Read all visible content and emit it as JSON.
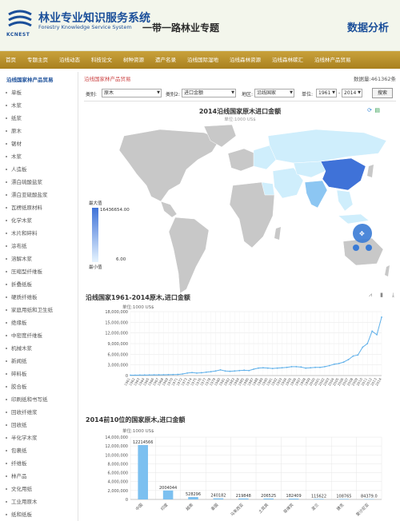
{
  "header": {
    "logo_text": "KCNEST",
    "title": "林业专业知识服务系统",
    "subtitle": "Forestry Knowledge Service System",
    "topic": "一带一路林业专题",
    "right_title": "数据分析"
  },
  "nav": [
    "首页",
    "专题主页",
    "沿线动态",
    "科技论文",
    "树种资源",
    "遗产名录",
    "沿线国际湿地",
    "沿线森林资源",
    "沿线森林碳汇",
    "沿线林产品贸易"
  ],
  "sidebar": {
    "title": "沿线国家林产品贸易",
    "items": [
      "单板",
      "木浆",
      "纸浆",
      "原木",
      "锯材",
      "木浆",
      "人造板",
      "漂白硫酸盐浆",
      "漂白亚硫酸盐浆",
      "瓦楞纸原材料",
      "化学木浆",
      "木片和碎料",
      "涂布纸",
      "溶解木浆",
      "压缩型纤维板",
      "折叠纸板",
      "硬质纤维板",
      "家庭用纸和卫生纸",
      "绝缘板",
      "中密度纤维板",
      "机械木浆",
      "新闻纸",
      "碎料板",
      "胶合板",
      "印刷纸和书写纸",
      "回收纤维浆",
      "回收纸",
      "半化学木浆",
      "包裹纸",
      "纤维板",
      "林产品",
      "文化用纸",
      "工业用原木",
      "纸和纸板"
    ]
  },
  "main": {
    "breadcrumb": "沿线国家林产品贸易",
    "data_count": "数据量:461362条"
  },
  "filters": {
    "category_label": "类别:",
    "category_value": "原木",
    "category2_label": "类别2:",
    "category2_value": "进口金额",
    "region_label": "地区:",
    "region_value": "沿线国家",
    "unit_label": "单位:",
    "year_from": "1961",
    "year_sep": "-",
    "year_to": "2014",
    "search_label": "搜索"
  },
  "map": {
    "title": "2014沿线国家原木进口金额",
    "unit": "单位:1000 US$",
    "legend_max_label": "最大值",
    "legend_max_value": "16436654.00",
    "legend_min_label": "最小值",
    "legend_min_value": "6.00",
    "colors": {
      "land": "#c8c8c8",
      "light": "#cfeefc",
      "mid": "#8cc6f2",
      "china": "#3f72d8"
    }
  },
  "chart_data": [
    {
      "type": "line",
      "title": "沿线国家1961-2014原木,进口金额",
      "ylabel": "单位:1000 US$",
      "ylim": [
        0,
        18000000
      ],
      "yticks": [
        "18,000,000",
        "15,000,000",
        "12,000,000",
        "9,000,000",
        "6,000,000",
        "3,000,000",
        "0"
      ],
      "x": [
        "1961",
        "1962",
        "1963",
        "1964",
        "1965",
        "1966",
        "1967",
        "1968",
        "1969",
        "1970",
        "1971",
        "1972",
        "1973",
        "1974",
        "1975",
        "1976",
        "1977",
        "1978",
        "1979",
        "1980",
        "1981",
        "1982",
        "1983",
        "1984",
        "1985",
        "1986",
        "1987",
        "1988",
        "1989",
        "1990",
        "1991",
        "1992",
        "1993",
        "1994",
        "1995",
        "1996",
        "1997",
        "1998",
        "1999",
        "2000",
        "2001",
        "2002",
        "2003",
        "2004",
        "2005",
        "2006",
        "2007",
        "2008",
        "2009",
        "2010",
        "2011",
        "2012",
        "2013",
        "2014"
      ],
      "values": [
        100000,
        120000,
        130000,
        150000,
        170000,
        200000,
        210000,
        230000,
        250000,
        280000,
        320000,
        450000,
        700000,
        850000,
        700000,
        800000,
        950000,
        1100000,
        1300000,
        1600000,
        1300000,
        1200000,
        1300000,
        1400000,
        1500000,
        1400000,
        1800000,
        2100000,
        2200000,
        2100000,
        2000000,
        2100000,
        2200000,
        2300000,
        2500000,
        2500000,
        2400000,
        2100000,
        2200000,
        2300000,
        2300000,
        2500000,
        2800000,
        3200000,
        3400000,
        3800000,
        4500000,
        5500000,
        5800000,
        8000000,
        9000000,
        12500000,
        11500000,
        16436654
      ],
      "grid": true
    },
    {
      "type": "bar",
      "title": "2014前10位的国家原木,进口金额",
      "ylabel": "单位:1000 US$",
      "ylim": [
        0,
        14000000
      ],
      "yticks": [
        "14,000,000",
        "12,000,000",
        "10,000,000",
        "8,000,000",
        "6,000,000",
        "4,000,000",
        "2,000,000",
        "0"
      ],
      "categories": [
        "中国",
        "印度",
        "越南",
        "泰国",
        "马来西亚",
        "土耳其",
        "菲律宾",
        "波兰",
        "捷克",
        "爱沙尼亚"
      ],
      "values": [
        12214566,
        2004044,
        528296,
        240182,
        219848,
        206525,
        182409,
        115622,
        108765,
        84379
      ],
      "labels": [
        "12214566",
        "2004044",
        "528296",
        "240182",
        "219848",
        "206525",
        "182409",
        "115622",
        "108765",
        "84379.0"
      ],
      "grid": true
    }
  ]
}
